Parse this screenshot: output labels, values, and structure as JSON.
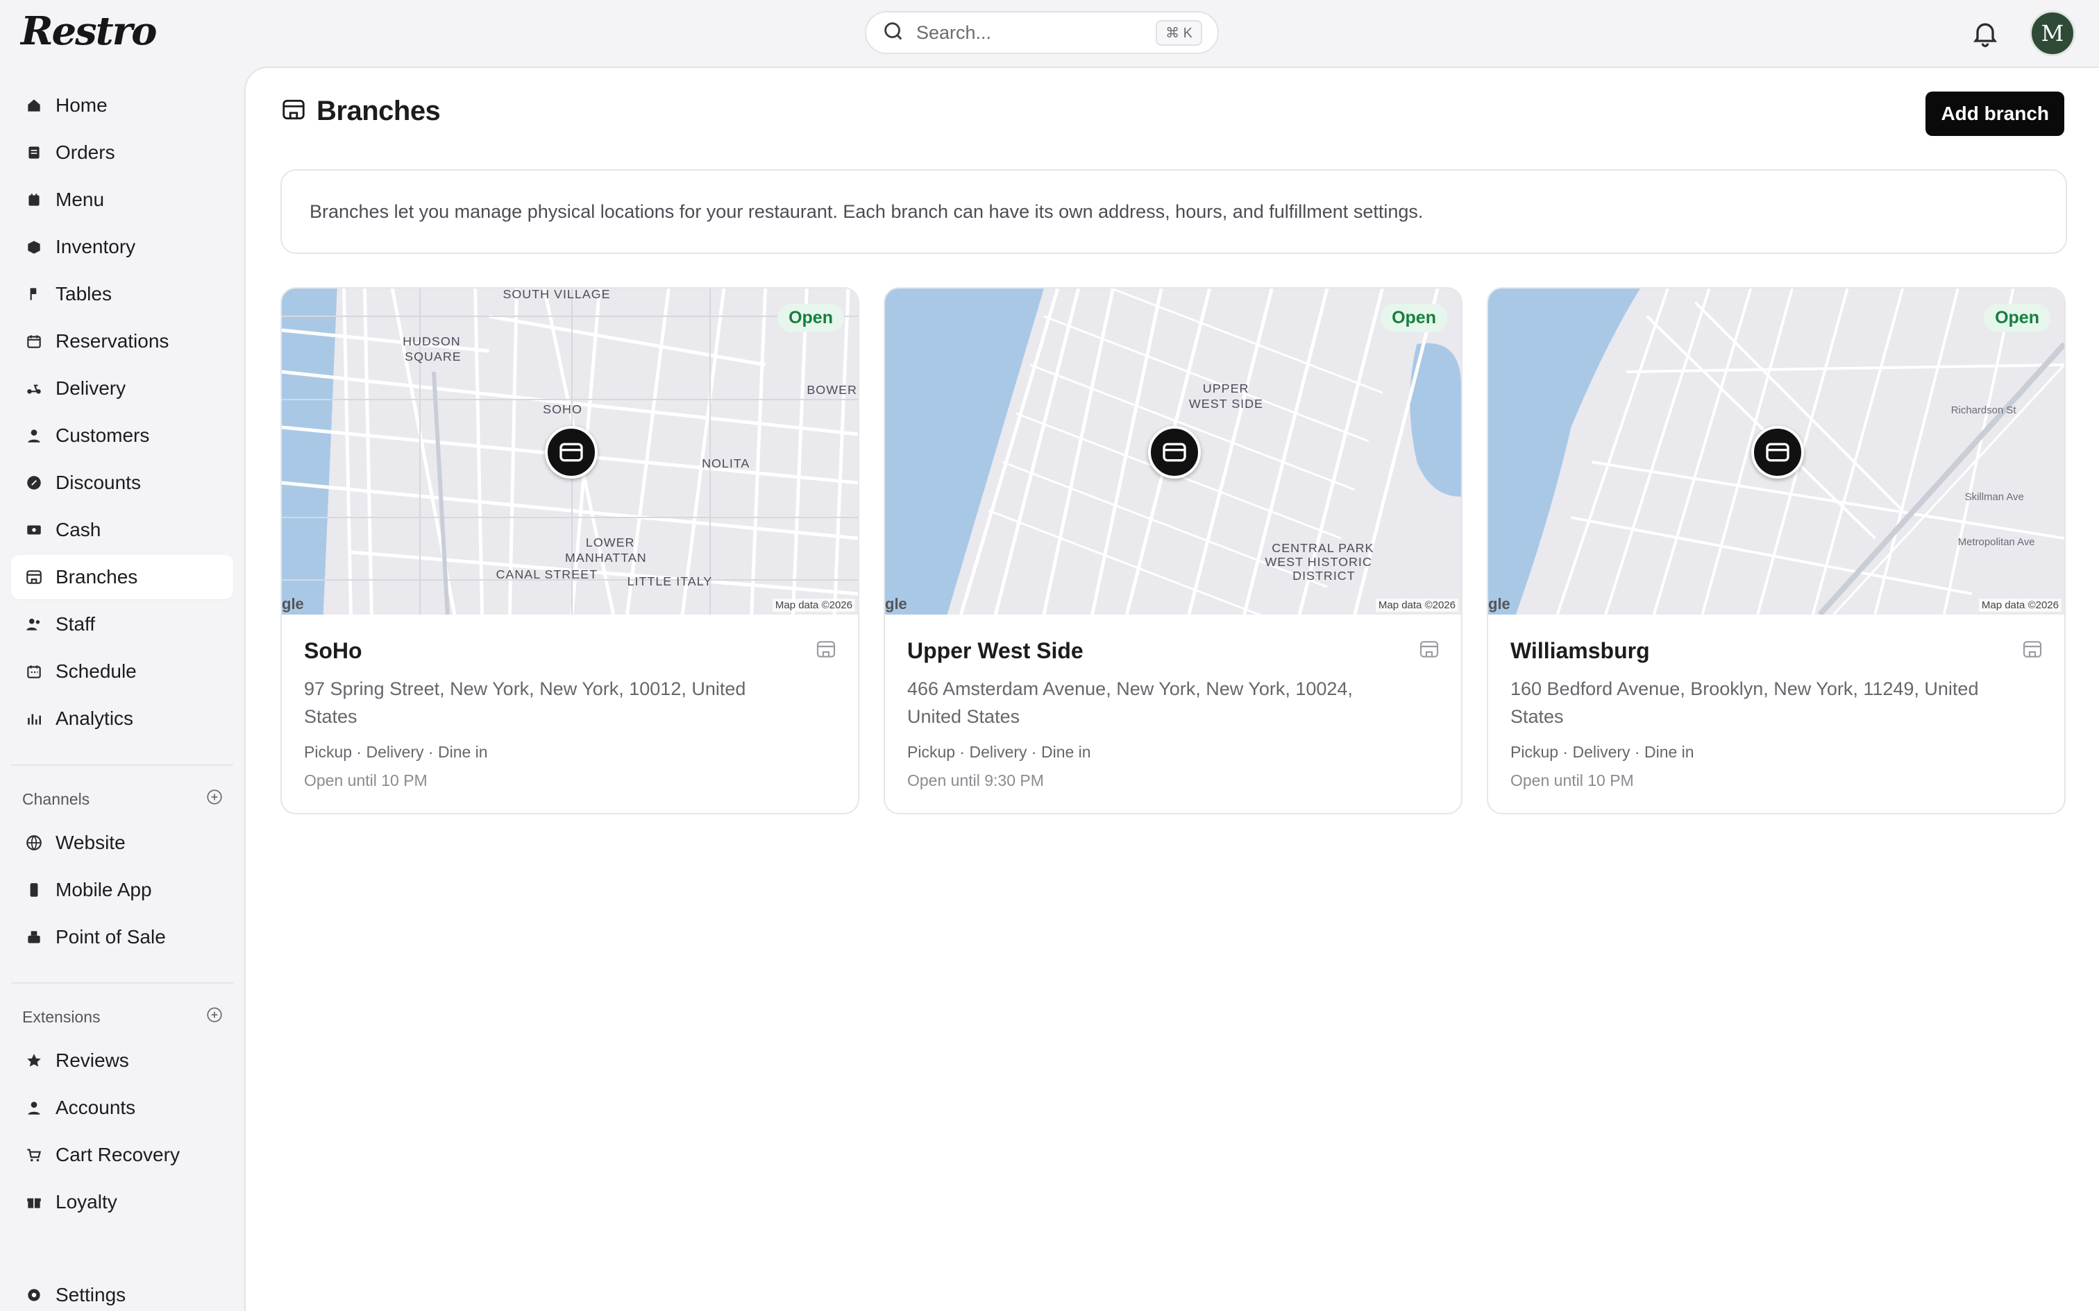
{
  "app": {
    "logo": "Restro"
  },
  "search": {
    "placeholder": "Search...",
    "shortcut": "⌘ K"
  },
  "user": {
    "initial": "M"
  },
  "sidebar": {
    "items": [
      {
        "label": "Home",
        "icon": "home-icon"
      },
      {
        "label": "Orders",
        "icon": "orders-icon"
      },
      {
        "label": "Menu",
        "icon": "menu-icon"
      },
      {
        "label": "Inventory",
        "icon": "inventory-icon"
      },
      {
        "label": "Tables",
        "icon": "tables-icon"
      },
      {
        "label": "Reservations",
        "icon": "calendar-icon"
      },
      {
        "label": "Delivery",
        "icon": "scooter-icon"
      },
      {
        "label": "Customers",
        "icon": "user-icon"
      },
      {
        "label": "Discounts",
        "icon": "discount-icon"
      },
      {
        "label": "Cash",
        "icon": "cash-icon"
      },
      {
        "label": "Branches",
        "icon": "store-icon",
        "active": true
      },
      {
        "label": "Staff",
        "icon": "staff-icon"
      },
      {
        "label": "Schedule",
        "icon": "schedule-icon"
      },
      {
        "label": "Analytics",
        "icon": "analytics-icon"
      }
    ],
    "channels": {
      "title": "Channels",
      "items": [
        {
          "label": "Website",
          "icon": "globe-icon"
        },
        {
          "label": "Mobile App",
          "icon": "mobile-icon"
        },
        {
          "label": "Point of Sale",
          "icon": "pos-icon"
        }
      ]
    },
    "extensions": {
      "title": "Extensions",
      "items": [
        {
          "label": "Reviews",
          "icon": "star-icon"
        },
        {
          "label": "Accounts",
          "icon": "user-icon"
        },
        {
          "label": "Cart Recovery",
          "icon": "cart-icon"
        },
        {
          "label": "Loyalty",
          "icon": "gift-icon"
        }
      ]
    },
    "settings": {
      "label": "Settings",
      "icon": "gear-icon"
    }
  },
  "page": {
    "title": "Branches",
    "add_button": "Add branch",
    "info": "Branches let you manage physical locations for your restaurant. Each branch can have its own address, hours, and fulfillment settings."
  },
  "branches": [
    {
      "name": "SoHo",
      "address": "97 Spring Street, New York, New York, 10012, United States",
      "fulfillment": "Pickup · Delivery · Dine in",
      "hours": "Open until 10 PM",
      "status": "Open",
      "map_credit": "Map data ©2026",
      "map_labels": [
        "SOUTH VILLAGE",
        "HUDSON",
        "SQUARE",
        "SOHO",
        "NOLITA",
        "BOWER",
        "LOWER",
        "MANHATTAN",
        "CANAL STREET",
        "LITTLE ITALY"
      ]
    },
    {
      "name": "Upper West Side",
      "address": "466 Amsterdam Avenue, New York, New York, 10024, United States",
      "fulfillment": "Pickup · Delivery · Dine in",
      "hours": "Open until 9:30 PM",
      "status": "Open",
      "map_credit": "Map data ©2026",
      "map_labels": [
        "UPPER",
        "WEST SIDE",
        "CENTRAL PARK",
        "WEST HISTORIC",
        "DISTRICT"
      ]
    },
    {
      "name": "Williamsburg",
      "address": "160 Bedford Avenue, Brooklyn, New York, 11249, United States",
      "fulfillment": "Pickup · Delivery · Dine in",
      "hours": "Open until 10 PM",
      "status": "Open",
      "map_credit": "Map data ©2026",
      "map_labels": [
        "Metropolitan Ave",
        "Skillman Ave",
        "Richardson St"
      ]
    }
  ],
  "colors": {
    "accent": "#0a0a0b",
    "open_badge_bg": "#e7f6ec",
    "open_badge_text": "#15803d",
    "map_land": "#e9e9ee",
    "map_water": "#a9c8e6"
  }
}
